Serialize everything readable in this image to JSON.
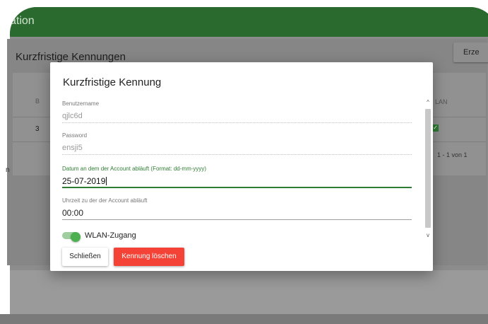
{
  "app": {
    "title_fragment": "ation"
  },
  "page": {
    "title": "Kurzfristige Kennungen",
    "create_button": "Erze"
  },
  "table": {
    "header_left": "B",
    "header_right": "LAN",
    "row_cell": "3",
    "checkbox_mark": "✓",
    "pagination": "1 - 1 von 1"
  },
  "sidebar": {
    "fragment": "n"
  },
  "dialog": {
    "title": "Kurzfristige Kennung",
    "fields": [
      {
        "label": "Benutzername",
        "value": "qjlc6d"
      },
      {
        "label": "Password",
        "value": "ensji5"
      },
      {
        "label": "Datum an dem der Account abläuft (Format: dd-mm-yyyy)",
        "value": "25-07-2019"
      },
      {
        "label": "Uhrzeit zu der der Account abläuft",
        "value": "00:00"
      }
    ],
    "toggle": {
      "label": "WLAN-Zugang",
      "on": true
    },
    "buttons": {
      "close": "Schließen",
      "delete": "Kennung löschen"
    },
    "scroll": {
      "up": "^",
      "down": "v"
    }
  },
  "colors": {
    "appbar": "#2b6a2e",
    "accent_green": "#2e7d32",
    "delete_red": "#f44336"
  }
}
